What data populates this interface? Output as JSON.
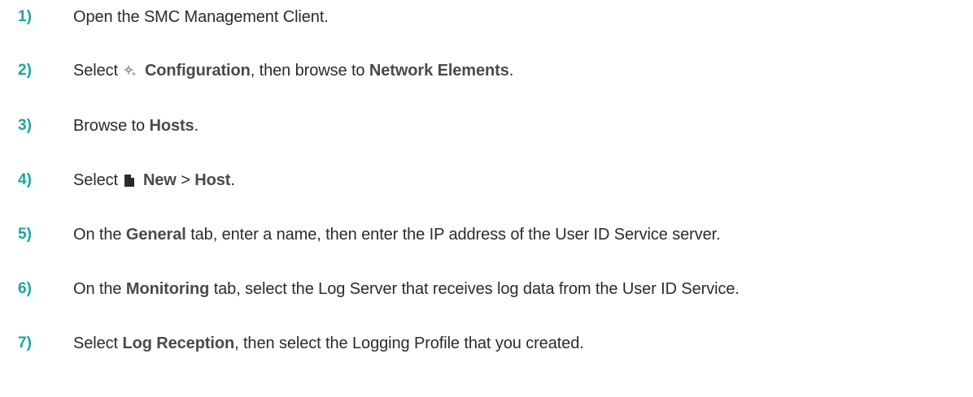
{
  "steps": [
    {
      "num": "1)",
      "parts": [
        "Open the SMC Management Client."
      ]
    },
    {
      "num": "2)",
      "select": "Select",
      "icon": "gear-icon",
      "bold1": "Configuration",
      "mid": ", then browse to",
      "bold2": "Network Elements",
      "end": "."
    },
    {
      "num": "3)",
      "pre": "Browse to",
      "bold1": "Hosts",
      "end": "."
    },
    {
      "num": "4)",
      "select": "Select",
      "icon": "new-document-icon",
      "bold1": "New",
      "mid": ">",
      "bold2": "Host",
      "end": "."
    },
    {
      "num": "5)",
      "pre": "On the",
      "bold1": "General",
      "rest": "tab, enter a name, then enter the IP address of the User ID Service server."
    },
    {
      "num": "6)",
      "pre": "On the",
      "bold1": "Monitoring",
      "rest": "tab, select the Log Server that receives log data from the User ID Service."
    },
    {
      "num": "7)",
      "pre": "Select",
      "bold1": "Log Reception",
      "rest": ", then select the Logging Profile that you created."
    }
  ],
  "colors": {
    "step_number": "#17a79a",
    "text": "#2b2b2b",
    "bold": "#4a4a4a"
  }
}
